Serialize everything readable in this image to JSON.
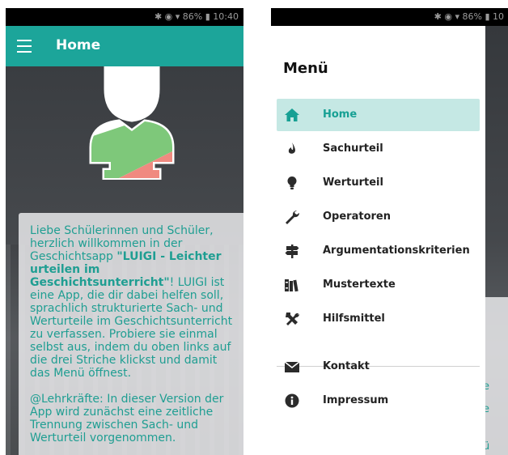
{
  "left": {
    "statusbar": {
      "text": "✱ ◉ ▾ 86% ▮ 10:40"
    },
    "appbar": {
      "title": "Home"
    },
    "welcome": {
      "p1_before": "Liebe Schülerinnen und Schüler, herzlich willkommen in der Geschichtsapp ",
      "p1_bold": "\"LUIGI - Leichter urteilen im Geschichtsunterricht\"",
      "p1_after": "! LUIGI ist eine App, die dir dabei helfen soll, sprachlich strukturierte Sach- und Werturteile im Geschichtsunterricht zu verfassen. Probiere sie einmal selbst aus, indem du oben links auf die drei Striche klickst und damit das Menü öffnest.",
      "p2": "@Lehrkräfte: In dieser Version der App wird zunächst eine zeitliche Trennung zwischen Sach- und Werturteil vorgenommen."
    }
  },
  "right": {
    "statusbar": {
      "text": "✱ ◉ ▾ 86% ▮ 10"
    },
    "drawer": {
      "title": "Menü",
      "items": [
        {
          "label": "Home",
          "icon": "home-icon"
        },
        {
          "label": "Sachurteil",
          "icon": "flame-icon"
        },
        {
          "label": "Werturteil",
          "icon": "lightbulb-icon"
        },
        {
          "label": "Operatoren",
          "icon": "wrench-icon"
        },
        {
          "label": "Argumentationskriterien",
          "icon": "signpost-icon"
        },
        {
          "label": "Mustertexte",
          "icon": "books-icon"
        },
        {
          "label": "Hilfsmittel",
          "icon": "tools-icon"
        }
      ],
      "secondary": [
        {
          "label": "Kontakt",
          "icon": "mail-icon"
        },
        {
          "label": "Impressum",
          "icon": "info-icon"
        }
      ]
    },
    "peek": {
      "t1": "e",
      "t2": "e",
      "t3": "ü"
    }
  },
  "colors": {
    "accent": "#1ca59a",
    "active_bg": "#c5e8e4",
    "bust_green": "#7ec87a",
    "bust_red": "#f08a80"
  }
}
